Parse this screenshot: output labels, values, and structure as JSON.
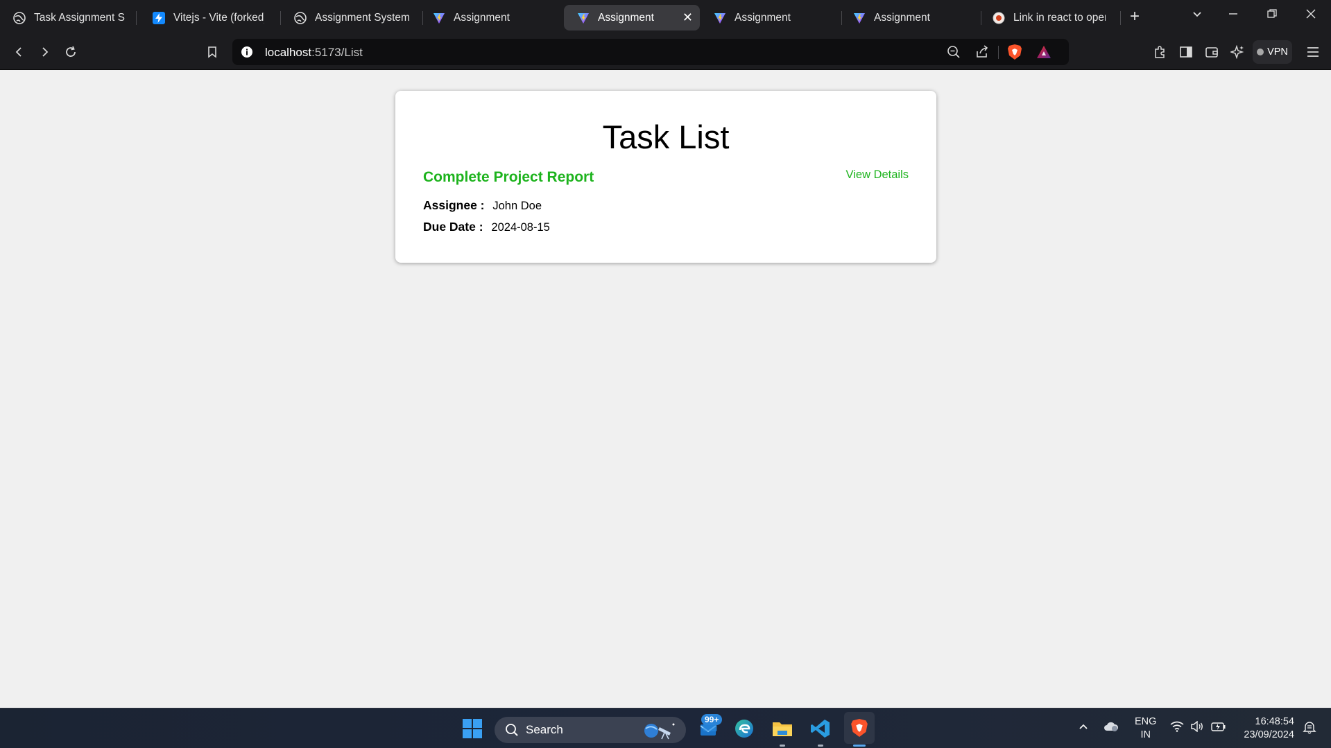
{
  "browser": {
    "tabs": [
      {
        "title": "Task Assignment Syst",
        "favicon": "globe-icon",
        "active": false
      },
      {
        "title": "Vitejs - Vite (forked)",
        "favicon": "stackblitz-bolt-icon",
        "active": false
      },
      {
        "title": "Assignment System",
        "favicon": "globe-icon",
        "active": false
      },
      {
        "title": "Assignment",
        "favicon": "vite-icon",
        "active": false
      },
      {
        "title": "Assignment",
        "favicon": "vite-icon",
        "active": true
      },
      {
        "title": "Assignment",
        "favicon": "vite-icon",
        "active": false
      },
      {
        "title": "Assignment",
        "favicon": "vite-icon",
        "active": false
      },
      {
        "title": "Link in react to open",
        "favicon": "record-icon",
        "active": false
      }
    ],
    "url_host": "localhost",
    "url_path": ":5173/List",
    "vpn_label": "VPN"
  },
  "page": {
    "title": "Task List",
    "tasks": [
      {
        "title": "Complete Project Report",
        "view_label": "View Details",
        "assignee_label": "Assignee :",
        "assignee": "John Doe",
        "due_label": "Due Date :",
        "due_date": "2024-08-15"
      }
    ]
  },
  "taskbar": {
    "search_label": "Search",
    "mail_badge": "99+",
    "lang_top": "ENG",
    "lang_bottom": "IN",
    "time": "16:48:54",
    "date": "23/09/2024"
  },
  "colors": {
    "accent_green": "#1db31d",
    "tab_bar_bg": "#1c1c1f",
    "page_bg": "#f0f0f0"
  }
}
